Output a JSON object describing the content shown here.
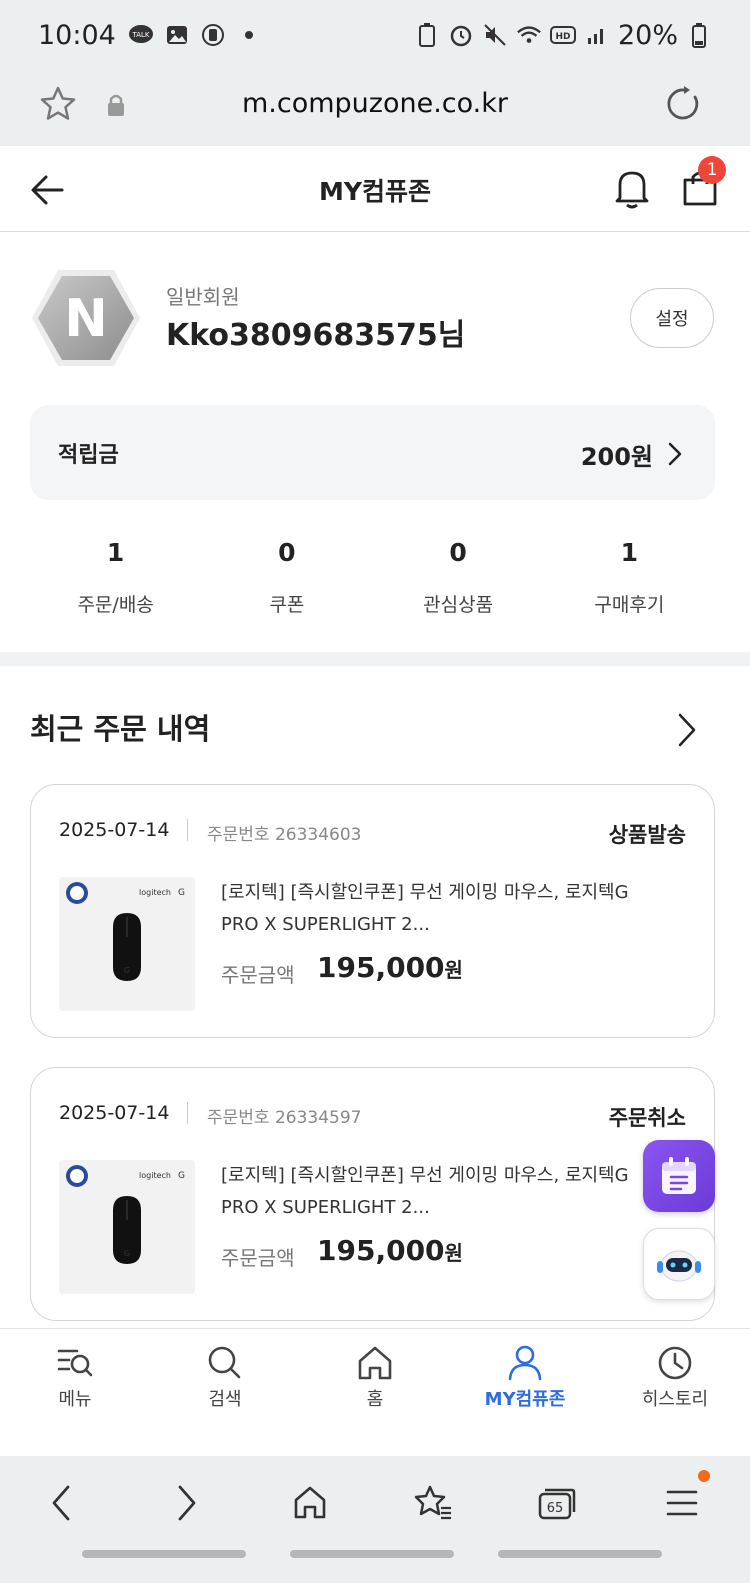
{
  "status_bar": {
    "time": "10:04",
    "battery": "20%"
  },
  "browser": {
    "url": "m.compuzone.co.kr",
    "tab_count": "65"
  },
  "header": {
    "title": "MY컴퓨존",
    "cart_count": "1"
  },
  "profile": {
    "avatar_letter": "N",
    "member_type": "일반회원",
    "username": "Kko3809683575님",
    "settings_label": "설정"
  },
  "points": {
    "label": "적립금",
    "value": "200원"
  },
  "stats": [
    {
      "count": "1",
      "label": "주문/배송"
    },
    {
      "count": "0",
      "label": "쿠폰"
    },
    {
      "count": "0",
      "label": "관심상품"
    },
    {
      "count": "1",
      "label": "구매후기"
    }
  ],
  "recent_orders": {
    "title": "최근 주문 내역",
    "orders": [
      {
        "date": "2025-07-14",
        "order_no": "주문번호 26334603",
        "status": "상품발송",
        "product_title": "[로지텍] [즉시할인쿠폰] 무선 게이밍 마우스, 로지텍G PRO X SUPERLIGHT 2...",
        "amount_label": "주문금액",
        "amount": "195,000",
        "amount_unit": "원",
        "thumb_brand": "logitech"
      },
      {
        "date": "2025-07-14",
        "order_no": "주문번호 26334597",
        "status": "주문취소",
        "product_title": "[로지텍] [즉시할인쿠폰] 무선 게이밍 마우스, 로지텍G PRO X SUPERLIGHT 2...",
        "amount_label": "주문금액",
        "amount": "195,000",
        "amount_unit": "원",
        "thumb_brand": "logitech"
      }
    ]
  },
  "bottom_nav": [
    {
      "label": "메뉴",
      "icon": "menu-search-icon"
    },
    {
      "label": "검색",
      "icon": "search-icon"
    },
    {
      "label": "홈",
      "icon": "home-icon"
    },
    {
      "label": "MY컴퓨존",
      "icon": "person-icon",
      "active": true
    },
    {
      "label": "히스토리",
      "icon": "clock-icon"
    }
  ],
  "colors": {
    "accent": "#2d6de0",
    "badge": "#f0453a",
    "float_purple": "#7a45e6"
  }
}
